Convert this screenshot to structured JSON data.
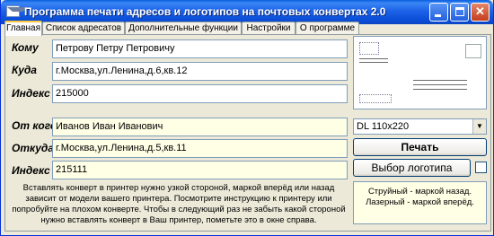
{
  "window": {
    "title": "Программа печати адресов и логотипов на почтовых конвертах 2.0",
    "min_symbol": "_",
    "max_symbol": "□",
    "close_symbol": "✕"
  },
  "tabs": [
    {
      "label": "Главная",
      "active": true
    },
    {
      "label": "Список адресатов",
      "active": false
    },
    {
      "label": "Дополнительные функции",
      "active": false
    },
    {
      "label": "Настройки",
      "active": false
    },
    {
      "label": "О программе",
      "active": false
    }
  ],
  "recipient": {
    "to_label": "Кому",
    "to_value": "Петрову Петру Петровичу",
    "where_label": "Куда",
    "where_value": "г.Москва,ул.Ленина,д.6,кв.12",
    "index_label": "Индекс",
    "index_value": "215000"
  },
  "sender": {
    "from_label": "От кого",
    "from_value": "Иванов Иван Иванович",
    "whence_label": "Откуда",
    "whence_value": "г.Москва,ул.Ленина,д.5,кв.11",
    "index_label": "Индекс",
    "index_value": "215111"
  },
  "envelope": {
    "format_selected": "DL 110x220",
    "dropdown_icon": "chevron-down-icon"
  },
  "actions": {
    "print_label": "Печать",
    "logo_label": "Выбор логотипа"
  },
  "hint": "Вставлять конверт в принтер нужно узкой стороной, маркой вперёд или назад зависит от модели вашего принтера. Посмотрите инструкцию к принтеру или попробуйте на плохом конверте. Чтобы в следующий раз не забыть какой стороной нужно вставлять конверт в Ваш принтер, пометьте это в окне справа.",
  "printer_note": {
    "line1": "Струйный - маркой назад.",
    "line2": "Лазерный - маркой вперёд."
  },
  "colors": {
    "titlebar": "#0B4FD8",
    "window_bg": "#ECE9D8",
    "sender_field_bg": "#FFFFE6",
    "active_tab_accent": "#FFC83C"
  }
}
